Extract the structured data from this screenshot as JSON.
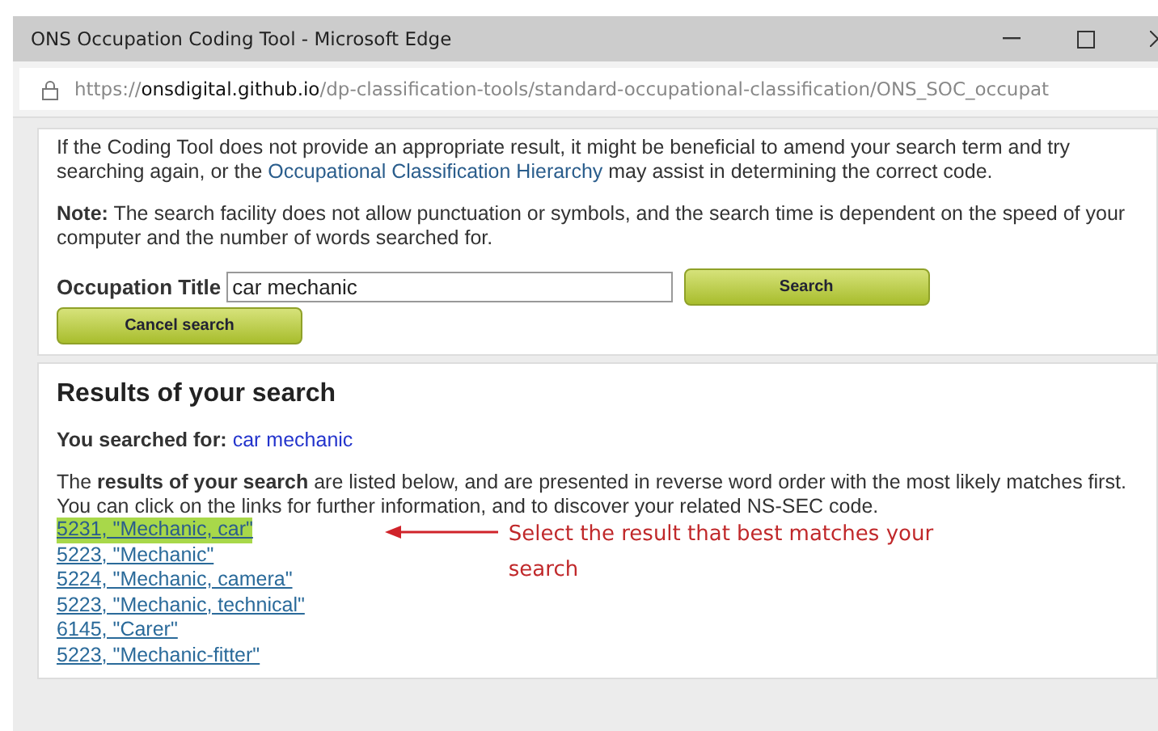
{
  "window": {
    "title": "ONS Occupation Coding Tool - Microsoft Edge"
  },
  "address_bar": {
    "scheme": "https://",
    "host": "onsdigital.github.io",
    "path": "/dp-classification-tools/standard-occupational-classification/ONS_SOC_occupat"
  },
  "intro": {
    "before": "If the Coding Tool does not provide an appropriate result, it might be beneficial to amend your search term and try searching again, or the ",
    "link": "Occupational Classification Hierarchy",
    "after": " may assist in determining the correct code."
  },
  "note": "**Note:** The search facility does not allow punctuation or symbols, and the search time is dependent on the speed of your computer and the number of words searched for.",
  "form": {
    "label": "Occupation Title",
    "value": "car mechanic",
    "search_button": "Search",
    "cancel_button": "Cancel search"
  },
  "results": {
    "heading": "Results of your search",
    "searched_label": "You searched for:",
    "searched_value": "car mechanic",
    "description": "The **results of your search** are listed below, and are presented in reverse word order with the most likely matches first. You can click on the links for further information, and to discover your related NS-SEC code.",
    "items": [
      {
        "label": "5231, \"Mechanic, car\"",
        "selected": true
      },
      {
        "label": "5223, \"Mechanic\"",
        "selected": false
      },
      {
        "label": "5224, \"Mechanic, camera\"",
        "selected": false
      },
      {
        "label": "5223, \"Mechanic, technical\"",
        "selected": false
      },
      {
        "label": "6145, \"Carer\"",
        "selected": false
      },
      {
        "label": "5223, \"Mechanic-fitter\"",
        "selected": false
      }
    ]
  },
  "annotation": {
    "text": "Select the result that best matches your search"
  }
}
